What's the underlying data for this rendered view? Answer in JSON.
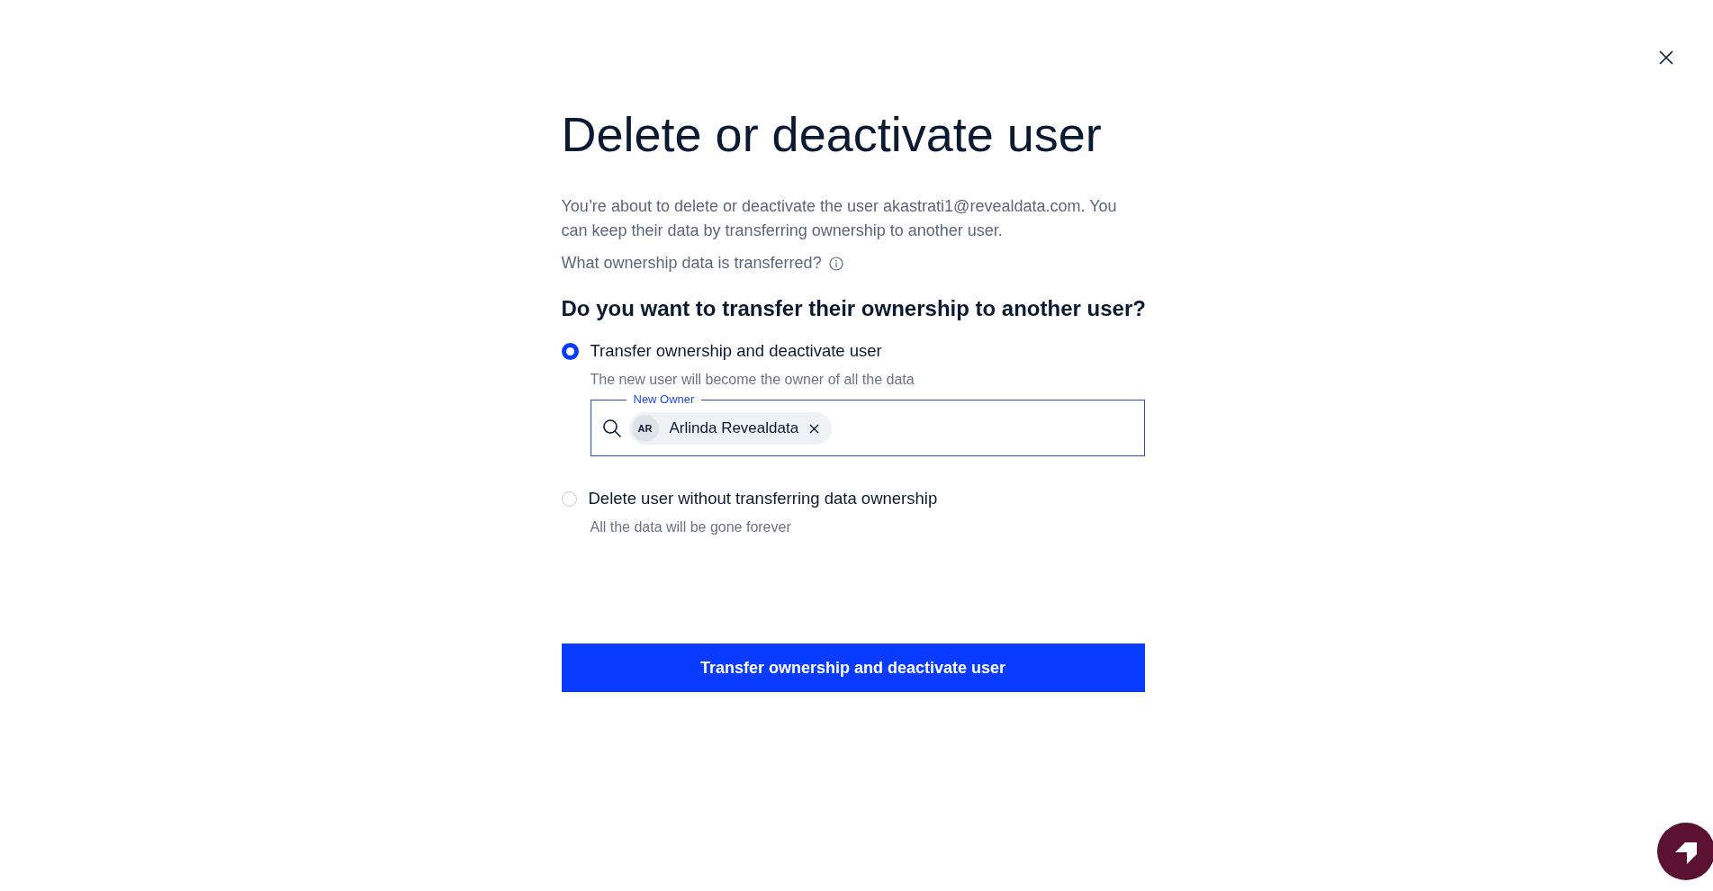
{
  "title": "Delete or deactivate user",
  "intro": "You’re about to delete or deactivate the user akastrati1@revealdata.com. You can keep their data by transferring ownership to another user.",
  "info_link": "What ownership data is transferred?",
  "question": "Do you want to transfer their ownership to another user?",
  "options": [
    {
      "label": "Transfer ownership and deactivate user",
      "hint": "The new user will become the owner of all the data",
      "selected": true,
      "owner_field": {
        "label": "New Owner",
        "chip": {
          "initials": "AR",
          "name": "Arlinda Revealdata"
        }
      }
    },
    {
      "label": "Delete user without transferring data ownership",
      "hint": "All the data will be gone forever",
      "selected": false
    }
  ],
  "submit": "Transfer ownership and deactivate user"
}
